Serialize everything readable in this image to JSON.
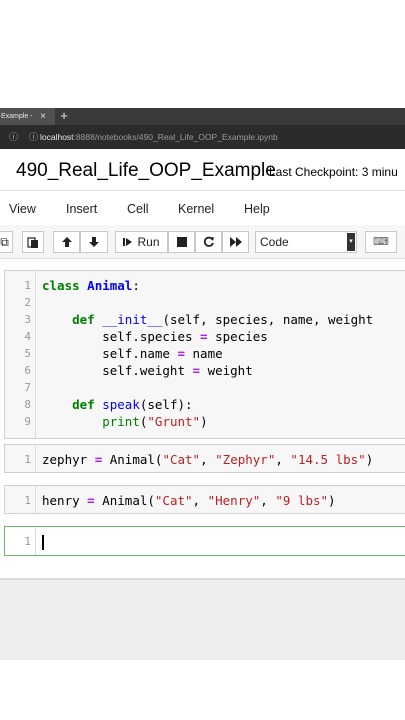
{
  "browser": {
    "tab_title": "Example -",
    "tab_close": "×",
    "new_tab": "+",
    "url_host": "localhost",
    "url_path": ":8888/notebooks/490_Real_Life_OOP_Example.ipynb"
  },
  "notebook": {
    "title": "490_Real_Life_OOP_Example",
    "checkpoint": "Last Checkpoint: 3 minu"
  },
  "menu": [
    "View",
    "Insert",
    "Cell",
    "Kernel",
    "Help"
  ],
  "toolbar": {
    "run_label": "Run",
    "cell_type": "Code"
  },
  "cells": [
    {
      "lines": [
        "1",
        "2",
        "3",
        "4",
        "5",
        "6",
        "7",
        "8",
        "9"
      ],
      "code": [
        [
          [
            "class",
            "kw"
          ],
          [
            " ",
            ""
          ],
          [
            "Animal",
            "cls"
          ],
          [
            ":",
            ""
          ]
        ],
        [],
        [
          [
            "    ",
            ""
          ],
          [
            "def",
            "kw"
          ],
          [
            " ",
            ""
          ],
          [
            "__init__",
            "fn"
          ],
          [
            "(self, species, name, weight",
            ""
          ]
        ],
        [
          [
            "        self.species ",
            ""
          ],
          [
            "=",
            "op"
          ],
          [
            " species",
            ""
          ]
        ],
        [
          [
            "        self.name ",
            ""
          ],
          [
            "=",
            "op"
          ],
          [
            " name",
            ""
          ]
        ],
        [
          [
            "        self.weight ",
            ""
          ],
          [
            "=",
            "op"
          ],
          [
            " weight",
            ""
          ]
        ],
        [],
        [
          [
            "    ",
            ""
          ],
          [
            "def",
            "kw"
          ],
          [
            " ",
            ""
          ],
          [
            "speak",
            "fn"
          ],
          [
            "(self):",
            ""
          ]
        ],
        [
          [
            "        ",
            ""
          ],
          [
            "print",
            "bi"
          ],
          [
            "(",
            ""
          ],
          [
            "\"Grunt\"",
            "str"
          ],
          [
            ")",
            ""
          ]
        ]
      ]
    },
    {
      "lines": [
        "1"
      ],
      "code": [
        [
          [
            "zephyr ",
            ""
          ],
          [
            "=",
            "op"
          ],
          [
            " Animal(",
            ""
          ],
          [
            "\"Cat\"",
            "str"
          ],
          [
            ", ",
            ""
          ],
          [
            "\"Zephyr\"",
            "str"
          ],
          [
            ", ",
            ""
          ],
          [
            "\"14.5 lbs\"",
            "str"
          ],
          [
            ")",
            ""
          ]
        ]
      ]
    },
    {
      "lines": [
        "1"
      ],
      "code": [
        [
          [
            "henry ",
            ""
          ],
          [
            "=",
            "op"
          ],
          [
            " Animal(",
            ""
          ],
          [
            "\"Cat\"",
            "str"
          ],
          [
            ", ",
            ""
          ],
          [
            "\"Henry\"",
            "str"
          ],
          [
            ", ",
            ""
          ],
          [
            "\"9 lbs\"",
            "str"
          ],
          [
            ")",
            ""
          ]
        ]
      ]
    },
    {
      "lines": [
        "1"
      ],
      "code": [
        []
      ]
    }
  ],
  "colors": {
    "keyword": "#008000",
    "operator": "#aa22ff",
    "string": "#ba2121",
    "function": "#0000ff",
    "active_cell_border": "#66bb6a"
  }
}
